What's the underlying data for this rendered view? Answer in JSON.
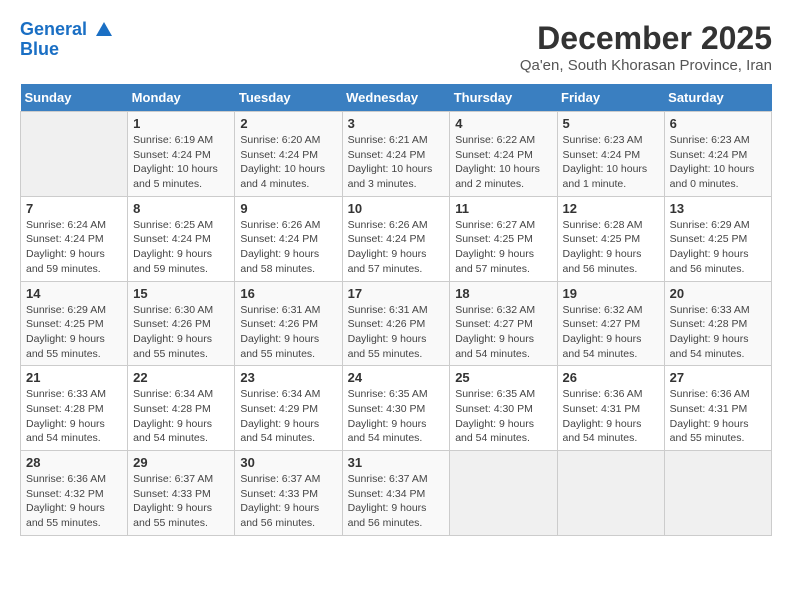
{
  "logo": {
    "line1": "General",
    "line2": "Blue"
  },
  "title": "December 2025",
  "subtitle": "Qa'en, South Khorasan Province, Iran",
  "weekdays": [
    "Sunday",
    "Monday",
    "Tuesday",
    "Wednesday",
    "Thursday",
    "Friday",
    "Saturday"
  ],
  "weeks": [
    [
      {
        "day": "",
        "info": ""
      },
      {
        "day": "1",
        "info": "Sunrise: 6:19 AM\nSunset: 4:24 PM\nDaylight: 10 hours\nand 5 minutes."
      },
      {
        "day": "2",
        "info": "Sunrise: 6:20 AM\nSunset: 4:24 PM\nDaylight: 10 hours\nand 4 minutes."
      },
      {
        "day": "3",
        "info": "Sunrise: 6:21 AM\nSunset: 4:24 PM\nDaylight: 10 hours\nand 3 minutes."
      },
      {
        "day": "4",
        "info": "Sunrise: 6:22 AM\nSunset: 4:24 PM\nDaylight: 10 hours\nand 2 minutes."
      },
      {
        "day": "5",
        "info": "Sunrise: 6:23 AM\nSunset: 4:24 PM\nDaylight: 10 hours\nand 1 minute."
      },
      {
        "day": "6",
        "info": "Sunrise: 6:23 AM\nSunset: 4:24 PM\nDaylight: 10 hours\nand 0 minutes."
      }
    ],
    [
      {
        "day": "7",
        "info": "Sunrise: 6:24 AM\nSunset: 4:24 PM\nDaylight: 9 hours\nand 59 minutes."
      },
      {
        "day": "8",
        "info": "Sunrise: 6:25 AM\nSunset: 4:24 PM\nDaylight: 9 hours\nand 59 minutes."
      },
      {
        "day": "9",
        "info": "Sunrise: 6:26 AM\nSunset: 4:24 PM\nDaylight: 9 hours\nand 58 minutes."
      },
      {
        "day": "10",
        "info": "Sunrise: 6:26 AM\nSunset: 4:24 PM\nDaylight: 9 hours\nand 57 minutes."
      },
      {
        "day": "11",
        "info": "Sunrise: 6:27 AM\nSunset: 4:25 PM\nDaylight: 9 hours\nand 57 minutes."
      },
      {
        "day": "12",
        "info": "Sunrise: 6:28 AM\nSunset: 4:25 PM\nDaylight: 9 hours\nand 56 minutes."
      },
      {
        "day": "13",
        "info": "Sunrise: 6:29 AM\nSunset: 4:25 PM\nDaylight: 9 hours\nand 56 minutes."
      }
    ],
    [
      {
        "day": "14",
        "info": "Sunrise: 6:29 AM\nSunset: 4:25 PM\nDaylight: 9 hours\nand 55 minutes."
      },
      {
        "day": "15",
        "info": "Sunrise: 6:30 AM\nSunset: 4:26 PM\nDaylight: 9 hours\nand 55 minutes."
      },
      {
        "day": "16",
        "info": "Sunrise: 6:31 AM\nSunset: 4:26 PM\nDaylight: 9 hours\nand 55 minutes."
      },
      {
        "day": "17",
        "info": "Sunrise: 6:31 AM\nSunset: 4:26 PM\nDaylight: 9 hours\nand 55 minutes."
      },
      {
        "day": "18",
        "info": "Sunrise: 6:32 AM\nSunset: 4:27 PM\nDaylight: 9 hours\nand 54 minutes."
      },
      {
        "day": "19",
        "info": "Sunrise: 6:32 AM\nSunset: 4:27 PM\nDaylight: 9 hours\nand 54 minutes."
      },
      {
        "day": "20",
        "info": "Sunrise: 6:33 AM\nSunset: 4:28 PM\nDaylight: 9 hours\nand 54 minutes."
      }
    ],
    [
      {
        "day": "21",
        "info": "Sunrise: 6:33 AM\nSunset: 4:28 PM\nDaylight: 9 hours\nand 54 minutes."
      },
      {
        "day": "22",
        "info": "Sunrise: 6:34 AM\nSunset: 4:28 PM\nDaylight: 9 hours\nand 54 minutes."
      },
      {
        "day": "23",
        "info": "Sunrise: 6:34 AM\nSunset: 4:29 PM\nDaylight: 9 hours\nand 54 minutes."
      },
      {
        "day": "24",
        "info": "Sunrise: 6:35 AM\nSunset: 4:30 PM\nDaylight: 9 hours\nand 54 minutes."
      },
      {
        "day": "25",
        "info": "Sunrise: 6:35 AM\nSunset: 4:30 PM\nDaylight: 9 hours\nand 54 minutes."
      },
      {
        "day": "26",
        "info": "Sunrise: 6:36 AM\nSunset: 4:31 PM\nDaylight: 9 hours\nand 54 minutes."
      },
      {
        "day": "27",
        "info": "Sunrise: 6:36 AM\nSunset: 4:31 PM\nDaylight: 9 hours\nand 55 minutes."
      }
    ],
    [
      {
        "day": "28",
        "info": "Sunrise: 6:36 AM\nSunset: 4:32 PM\nDaylight: 9 hours\nand 55 minutes."
      },
      {
        "day": "29",
        "info": "Sunrise: 6:37 AM\nSunset: 4:33 PM\nDaylight: 9 hours\nand 55 minutes."
      },
      {
        "day": "30",
        "info": "Sunrise: 6:37 AM\nSunset: 4:33 PM\nDaylight: 9 hours\nand 56 minutes."
      },
      {
        "day": "31",
        "info": "Sunrise: 6:37 AM\nSunset: 4:34 PM\nDaylight: 9 hours\nand 56 minutes."
      },
      {
        "day": "",
        "info": ""
      },
      {
        "day": "",
        "info": ""
      },
      {
        "day": "",
        "info": ""
      }
    ]
  ]
}
